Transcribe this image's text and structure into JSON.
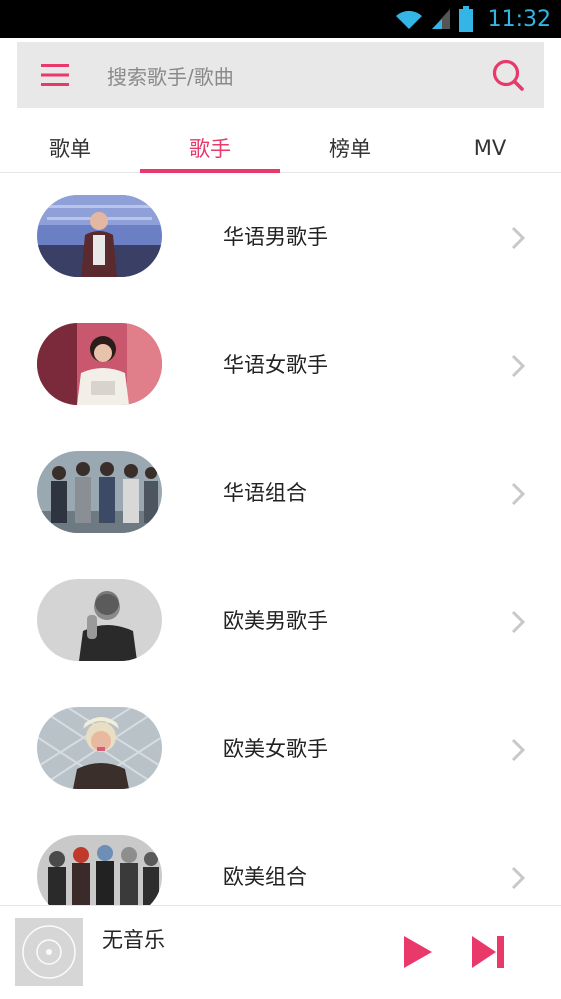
{
  "status_bar": {
    "time": "11:32"
  },
  "search": {
    "placeholder": "搜索歌手/歌曲"
  },
  "tabs": [
    {
      "label": "歌单",
      "active": false
    },
    {
      "label": "歌手",
      "active": true
    },
    {
      "label": "榜单",
      "active": false
    },
    {
      "label": "MV",
      "active": false
    }
  ],
  "singer_categories": [
    {
      "label": "华语男歌手"
    },
    {
      "label": "华语女歌手"
    },
    {
      "label": "华语组合"
    },
    {
      "label": "欧美男歌手"
    },
    {
      "label": "欧美女歌手"
    },
    {
      "label": "欧美组合"
    }
  ],
  "player": {
    "title": "无音乐"
  },
  "colors": {
    "accent": "#e9386a",
    "status_time": "#33b5e5"
  }
}
